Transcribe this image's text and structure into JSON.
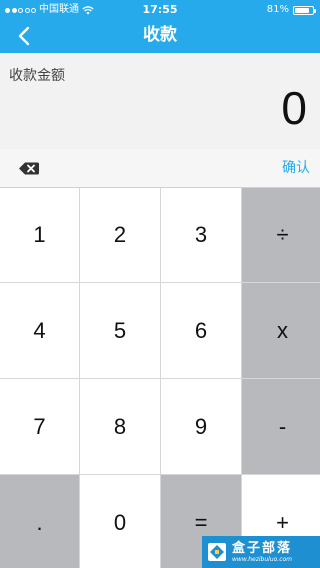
{
  "status_bar": {
    "carrier": "中国联通",
    "time": "17:55",
    "battery_percent": "81%",
    "battery_level": 0.81,
    "signal_bars_filled": 2,
    "signal_bars_total": 5
  },
  "nav": {
    "title": "收款",
    "back_icon": "chevron-left-icon"
  },
  "amount": {
    "label": "收款金额",
    "value": "0"
  },
  "toolbar": {
    "delete_icon": "backspace-icon",
    "confirm_label": "确认"
  },
  "keypad": {
    "keys": [
      {
        "label": "1",
        "name": "key-1",
        "style": "white"
      },
      {
        "label": "2",
        "name": "key-2",
        "style": "white"
      },
      {
        "label": "3",
        "name": "key-3",
        "style": "white"
      },
      {
        "label": "÷",
        "name": "key-divide",
        "style": "gray"
      },
      {
        "label": "4",
        "name": "key-4",
        "style": "white"
      },
      {
        "label": "5",
        "name": "key-5",
        "style": "white"
      },
      {
        "label": "6",
        "name": "key-6",
        "style": "white"
      },
      {
        "label": "x",
        "name": "key-multiply",
        "style": "gray"
      },
      {
        "label": "7",
        "name": "key-7",
        "style": "white"
      },
      {
        "label": "8",
        "name": "key-8",
        "style": "white"
      },
      {
        "label": "9",
        "name": "key-9",
        "style": "white"
      },
      {
        "label": "-",
        "name": "key-subtract",
        "style": "gray"
      },
      {
        "label": ".",
        "name": "key-decimal",
        "style": "gray"
      },
      {
        "label": "0",
        "name": "key-0",
        "style": "white"
      },
      {
        "label": "=",
        "name": "key-equals",
        "style": "gray"
      },
      {
        "label": "+",
        "name": "key-add",
        "style": "white"
      }
    ]
  },
  "watermark": {
    "brand": "盒子部落",
    "url": "www.hezibuluo.com"
  },
  "colors": {
    "accent": "#27aaec",
    "amount_bg": "#f2f2f3",
    "key_gray": "#b7b9bd",
    "key_white": "#ffffff",
    "watermark_bg": "#1e8fd0"
  }
}
